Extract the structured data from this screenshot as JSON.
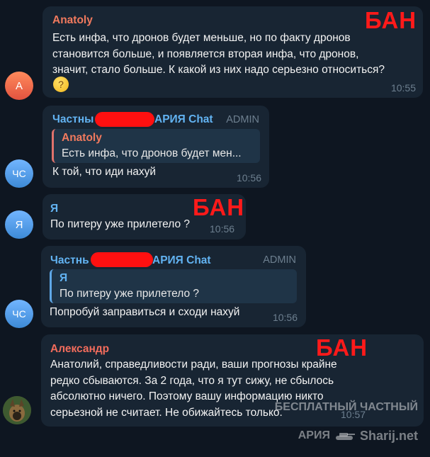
{
  "messages": [
    {
      "sender": "Anatoly",
      "avatar": "А",
      "text": "Есть инфа, что дронов будет меньше, но по факту дронов\nстановится больше, и появляется вторая инфа, что дронов,\nзначит, стало больше. К какой из них надо серьезно относиться?",
      "emoji": "thinking-face",
      "time": "10:55",
      "overlay": "БАН"
    },
    {
      "sender_left": "Частны",
      "sender_right": "АРИЯ Chat",
      "badge": "ADMIN",
      "avatar": "ЧС",
      "reply_name": "Anatoly",
      "reply_text": "Есть инфа, что дронов будет мен...",
      "text": "К той, что иди нахуй",
      "time": "10:56"
    },
    {
      "sender": "Я",
      "avatar": "Я",
      "text": "По питеру уже прилетело ?",
      "time": "10:56",
      "overlay": "БАН"
    },
    {
      "sender_left": "Частнь",
      "sender_right": "АРИЯ Chat",
      "badge": "ADMIN",
      "avatar": "ЧС",
      "reply_name": "Я",
      "reply_text": "По питеру уже прилетело ?",
      "text": "Попробуй заправиться и сходи нахуй",
      "time": "10:56"
    },
    {
      "sender": "Александр",
      "text": "Анатолий, справедливости ради, ваши прогнозы крайне\nредко сбываются. За 2 года, что я тут сижу, не сбылось\nабсолютно ничего. Поэтому вашу информацию никто\nсерьезной не считает. Не обижайтесь только.",
      "time": "10:57",
      "overlay": "БАН"
    }
  ],
  "watermark": {
    "line1": "БЕСПЛАТНЫЙ ЧАСТНЫЙ",
    "line2": "АРИЯ",
    "site": "Sharij.net"
  },
  "colors": {
    "background": "#0e1621",
    "bubble": "#182533",
    "anatoly_name": "#f17a5e",
    "admin_name": "#62b3f2",
    "ya_name": "#62b3f2",
    "aleksandr_name": "#f26c5c",
    "ban": "#ff1a1a"
  }
}
